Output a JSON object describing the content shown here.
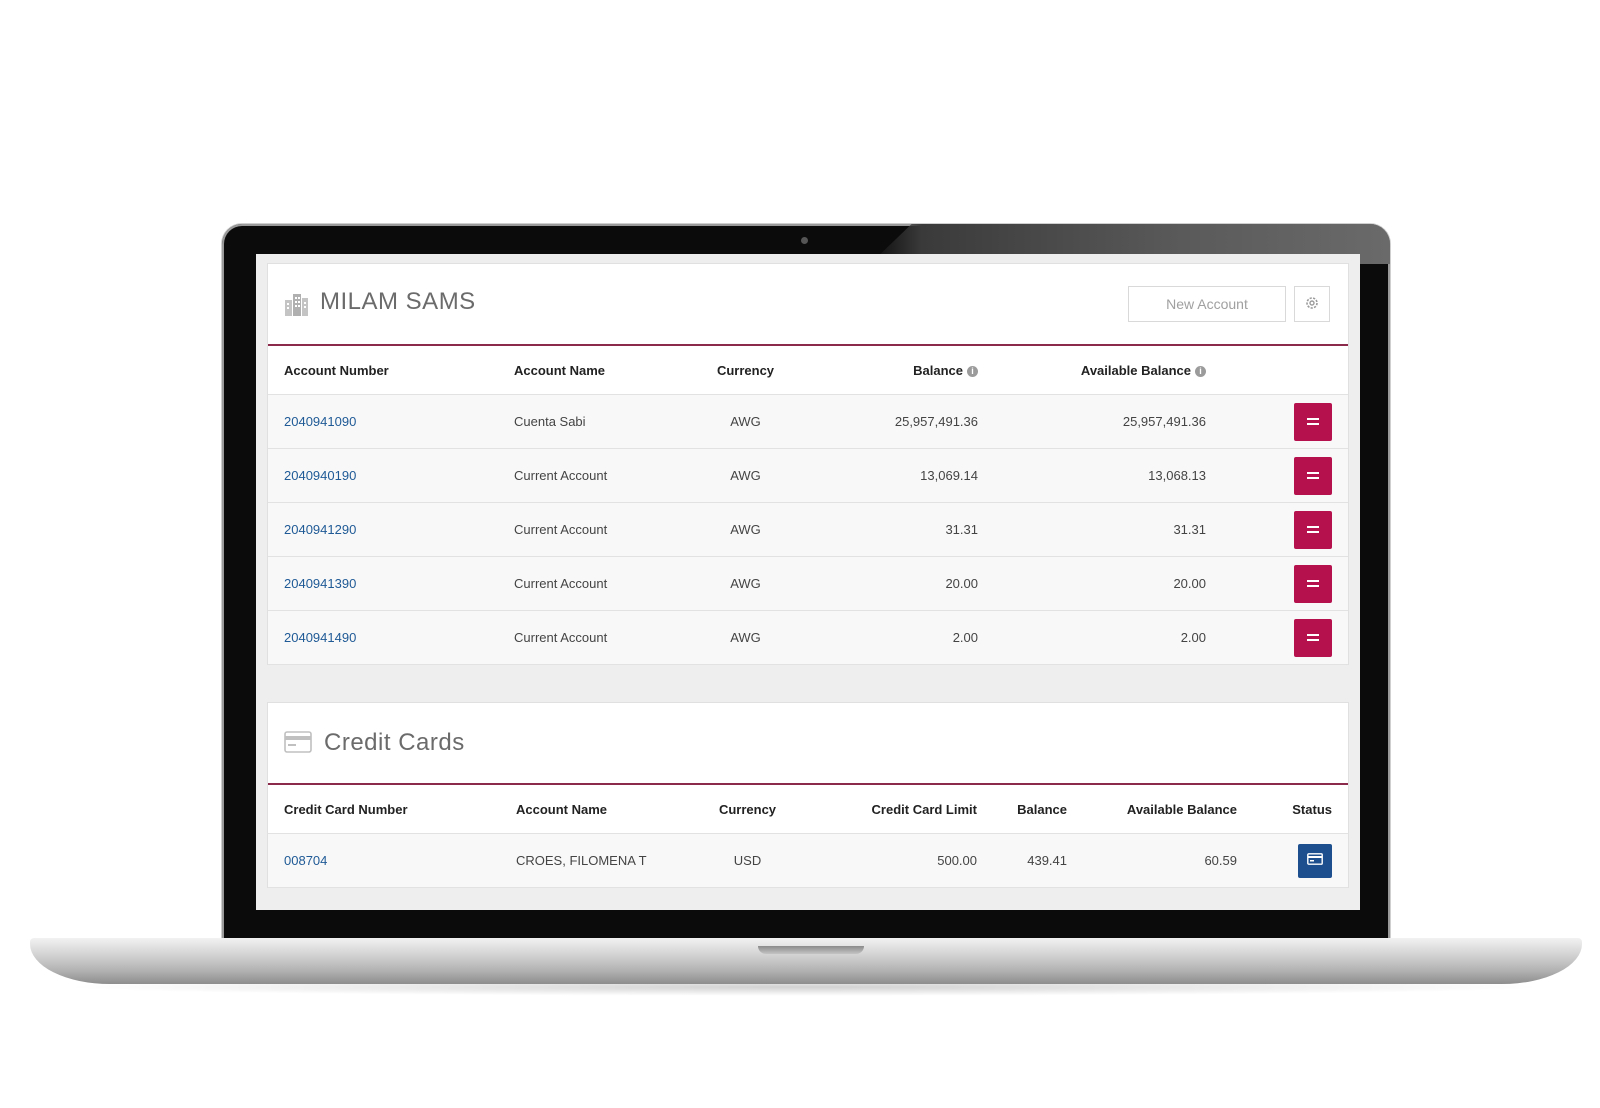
{
  "accounts_panel": {
    "title": "MILAM SAMS",
    "new_account_label": "New Account",
    "columns": {
      "account_number": "Account Number",
      "account_name": "Account Name",
      "currency": "Currency",
      "balance": "Balance",
      "available_balance": "Available Balance"
    },
    "rows": [
      {
        "number": "2040941090",
        "name": "Cuenta Sabi",
        "currency": "AWG",
        "balance": "25,957,491.36",
        "available": "25,957,491.36"
      },
      {
        "number": "2040940190",
        "name": "Current Account",
        "currency": "AWG",
        "balance": "13,069.14",
        "available": "13,068.13"
      },
      {
        "number": "2040941290",
        "name": "Current Account",
        "currency": "AWG",
        "balance": "31.31",
        "available": "31.31"
      },
      {
        "number": "2040941390",
        "name": "Current Account",
        "currency": "AWG",
        "balance": "20.00",
        "available": "20.00"
      },
      {
        "number": "2040941490",
        "name": "Current Account",
        "currency": "AWG",
        "balance": "2.00",
        "available": "2.00"
      }
    ]
  },
  "cards_panel": {
    "title": "Credit Cards",
    "columns": {
      "card_number": "Credit Card Number",
      "account_name": "Account Name",
      "currency": "Currency",
      "limit": "Credit Card Limit",
      "balance": "Balance",
      "available_balance": "Available Balance",
      "status": "Status"
    },
    "rows": [
      {
        "number": "008704",
        "name": "CROES, FILOMENA T",
        "currency": "USD",
        "limit": "500.00",
        "balance": "439.41",
        "available": "60.59"
      }
    ]
  },
  "icons": {
    "building": "building-icon",
    "gear": "gear-icon",
    "info": "info-icon",
    "menu": "menu-icon",
    "credit_card": "credit-card-icon"
  },
  "colors": {
    "accent_red": "#b5124d",
    "divider": "#8c2a4c",
    "link_blue": "#1f5a96",
    "status_blue": "#1d4f8f"
  }
}
